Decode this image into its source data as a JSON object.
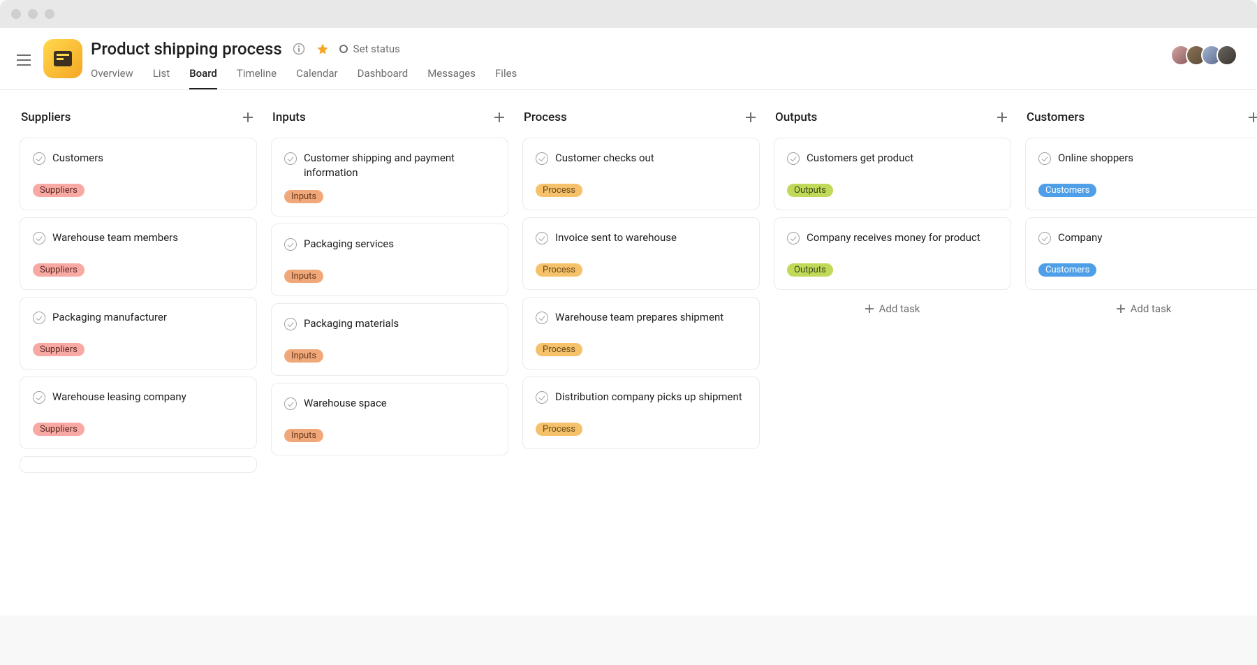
{
  "project": {
    "title": "Product shipping process",
    "set_status_label": "Set status"
  },
  "tabs": [
    {
      "label": "Overview",
      "active": false
    },
    {
      "label": "List",
      "active": false
    },
    {
      "label": "Board",
      "active": true
    },
    {
      "label": "Timeline",
      "active": false
    },
    {
      "label": "Calendar",
      "active": false
    },
    {
      "label": "Dashboard",
      "active": false
    },
    {
      "label": "Messages",
      "active": false
    },
    {
      "label": "Files",
      "active": false
    }
  ],
  "add_task_label": "Add task",
  "tag_labels": {
    "suppliers": "Suppliers",
    "inputs": "Inputs",
    "process": "Process",
    "outputs": "Outputs",
    "customers": "Customers"
  },
  "columns": [
    {
      "title": "Suppliers",
      "cards": [
        {
          "title": "Customers",
          "tag": "suppliers"
        },
        {
          "title": "Warehouse team members",
          "tag": "suppliers"
        },
        {
          "title": "Packaging manufacturer",
          "tag": "suppliers"
        },
        {
          "title": "Warehouse leasing company",
          "tag": "suppliers"
        }
      ],
      "has_more_placeholder": true
    },
    {
      "title": "Inputs",
      "cards": [
        {
          "title": "Customer shipping and payment information",
          "tag": "inputs"
        },
        {
          "title": "Packaging services",
          "tag": "inputs"
        },
        {
          "title": "Packaging materials",
          "tag": "inputs"
        },
        {
          "title": "Warehouse space",
          "tag": "inputs"
        }
      ]
    },
    {
      "title": "Process",
      "cards": [
        {
          "title": "Customer checks out",
          "tag": "process"
        },
        {
          "title": "Invoice sent to warehouse",
          "tag": "process"
        },
        {
          "title": "Warehouse team prepares shipment",
          "tag": "process"
        },
        {
          "title": "Distribution company picks up shipment",
          "tag": "process"
        }
      ]
    },
    {
      "title": "Outputs",
      "cards": [
        {
          "title": "Customers get product",
          "tag": "outputs"
        },
        {
          "title": "Company receives money for product",
          "tag": "outputs"
        }
      ],
      "show_add_task": true
    },
    {
      "title": "Customers",
      "cards": [
        {
          "title": "Online shoppers",
          "tag": "customers"
        },
        {
          "title": "Company",
          "tag": "customers"
        }
      ],
      "show_add_task": true
    }
  ]
}
